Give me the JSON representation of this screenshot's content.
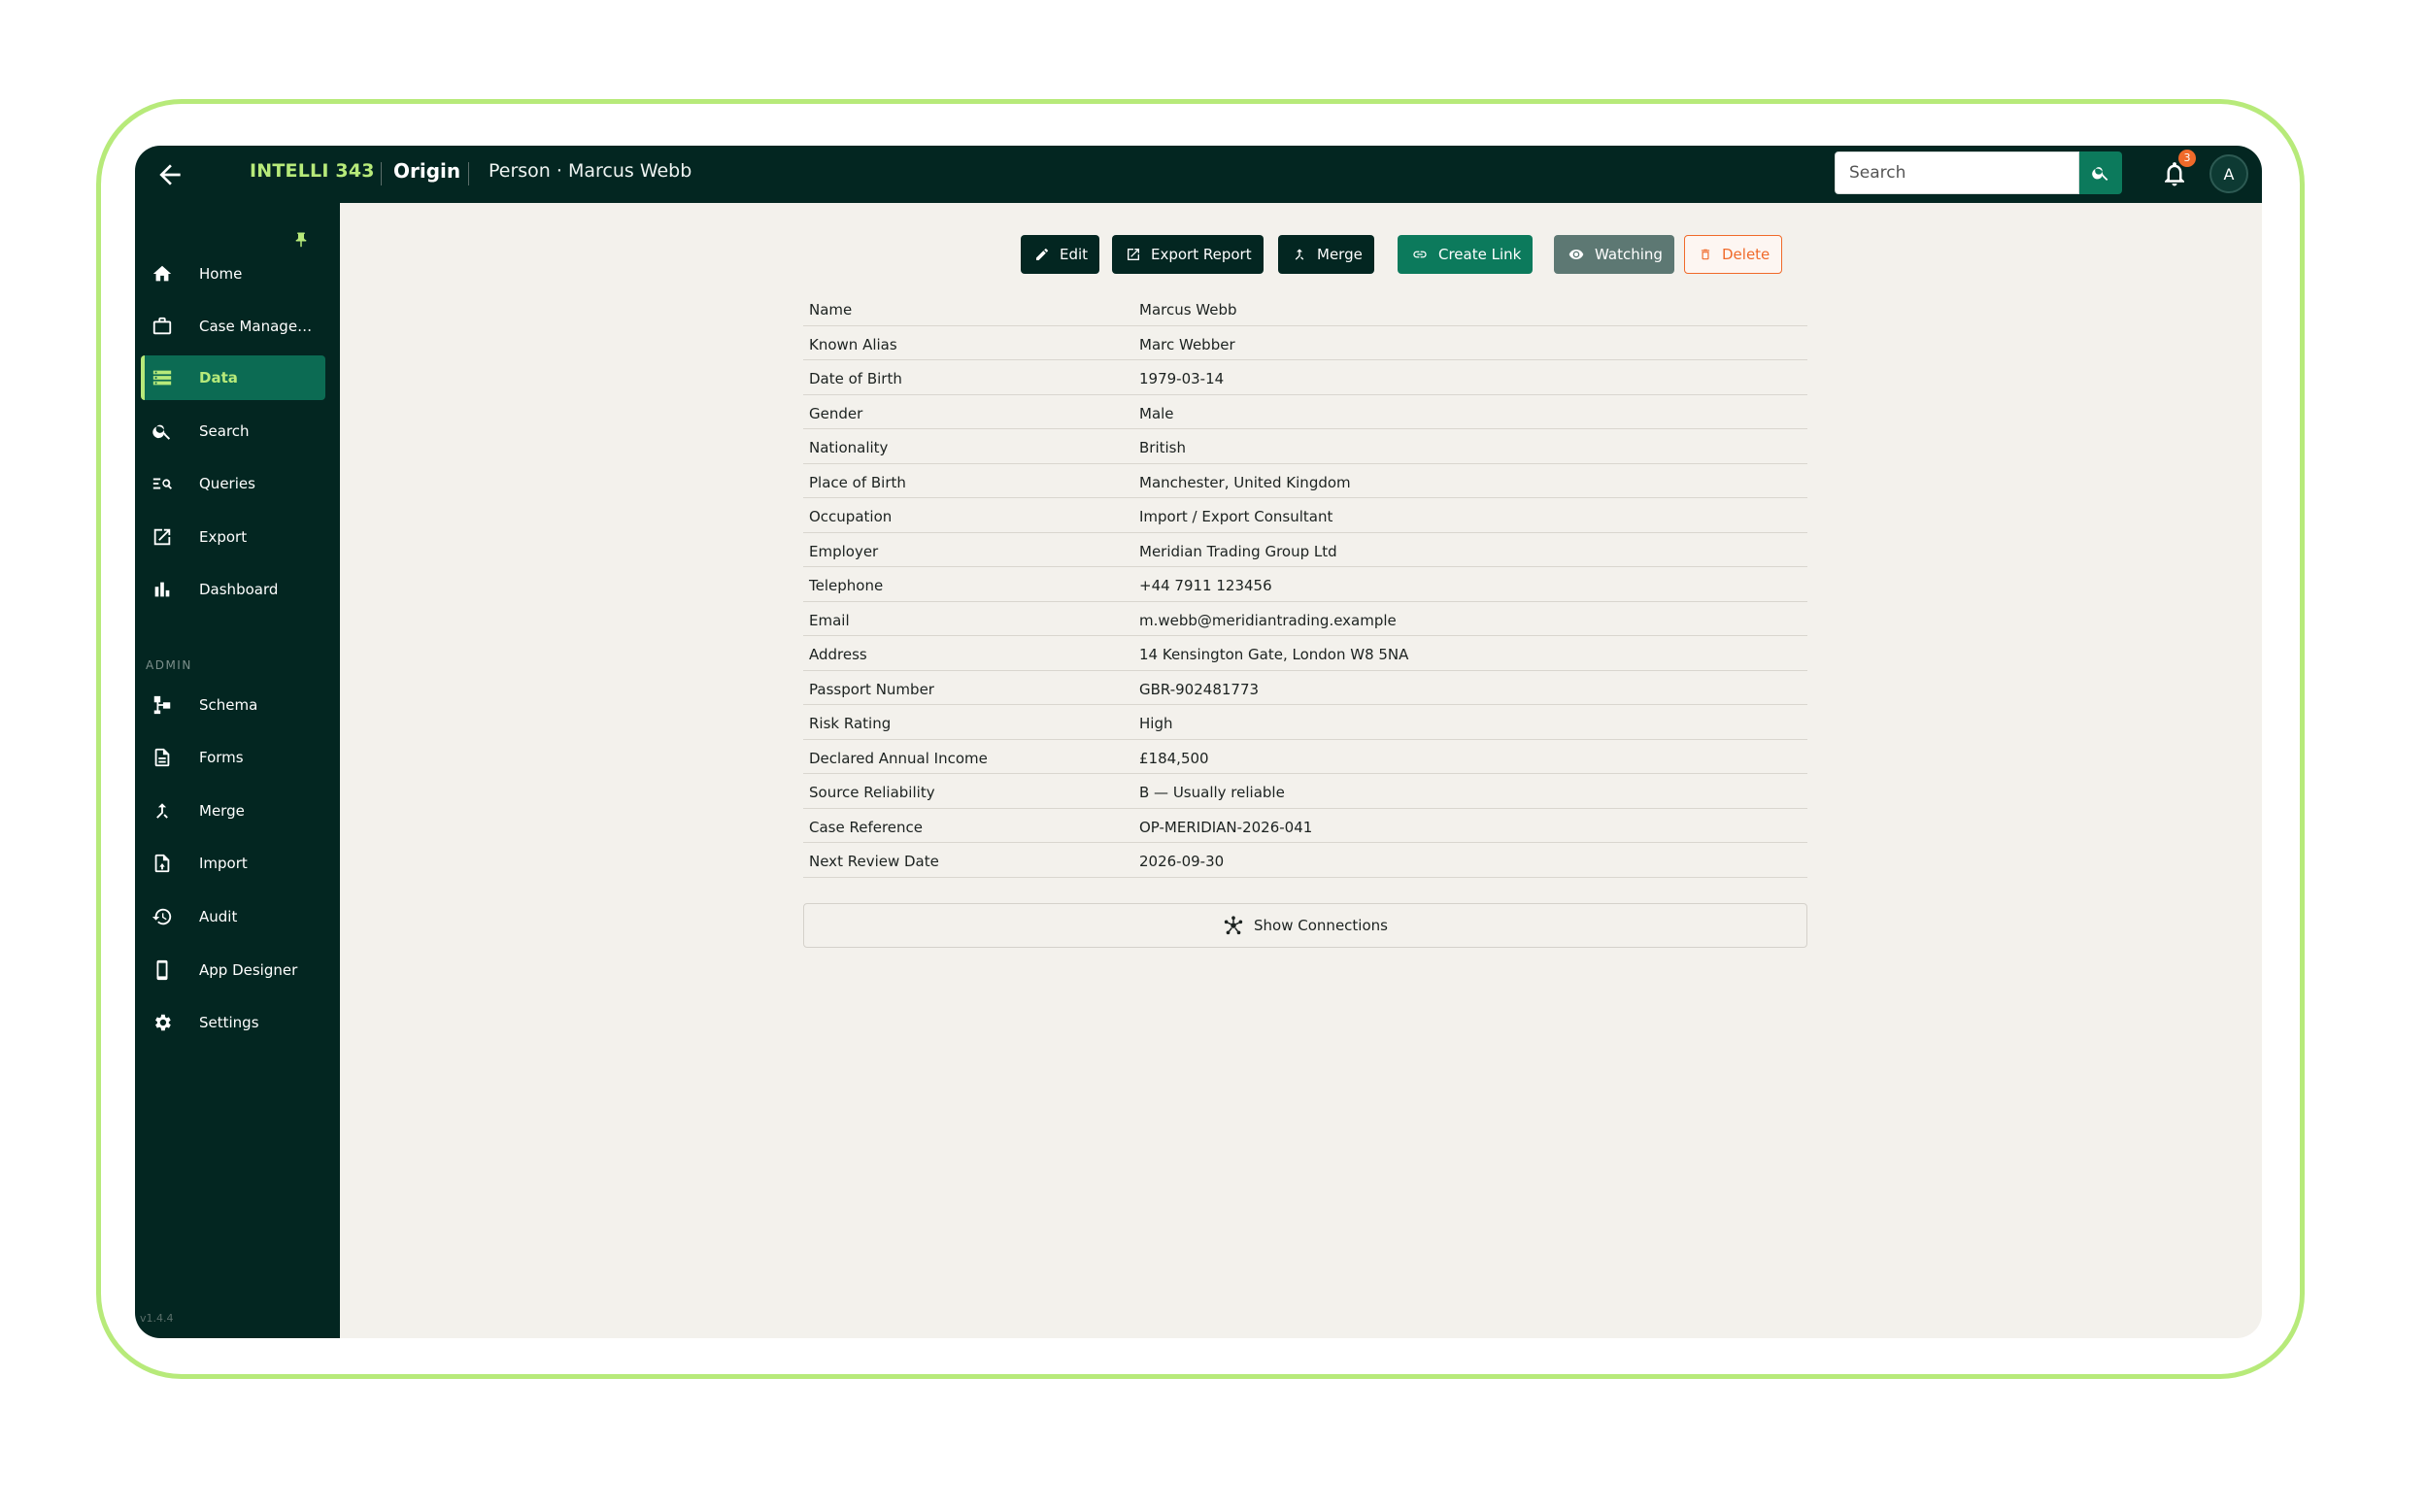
{
  "header": {
    "brand": "INTELLI 343",
    "app_name": "Origin",
    "page_title": "Person · Marcus Webb",
    "search_placeholder": "Search",
    "notification_count": "3",
    "avatar_initial": "A"
  },
  "sidebar": {
    "items": [
      {
        "label": "Home",
        "icon": "home-icon"
      },
      {
        "label": "Case Management",
        "icon": "briefcase-icon"
      },
      {
        "label": "Data",
        "icon": "data-list-icon",
        "active": true
      },
      {
        "label": "Search",
        "icon": "search-icon"
      },
      {
        "label": "Queries",
        "icon": "query-icon"
      },
      {
        "label": "Export",
        "icon": "export-icon"
      },
      {
        "label": "Dashboard",
        "icon": "bar-chart-icon"
      }
    ],
    "admin_label": "ADMIN",
    "admin_items": [
      {
        "label": "Schema",
        "icon": "schema-icon"
      },
      {
        "label": "Forms",
        "icon": "document-icon"
      },
      {
        "label": "Merge",
        "icon": "merge-icon"
      },
      {
        "label": "Import",
        "icon": "import-icon"
      },
      {
        "label": "Audit",
        "icon": "history-icon"
      },
      {
        "label": "App Designer",
        "icon": "phone-icon"
      },
      {
        "label": "Settings",
        "icon": "gear-icon"
      }
    ],
    "version": "v1.4.4"
  },
  "toolbar": {
    "edit": "Edit",
    "export_report": "Export Report",
    "merge": "Merge",
    "create_link": "Create Link",
    "watching": "Watching",
    "delete": "Delete"
  },
  "record": {
    "fields": [
      {
        "key": "Name",
        "value": "Marcus Webb"
      },
      {
        "key": "Known Alias",
        "value": "Marc Webber"
      },
      {
        "key": "Date of Birth",
        "value": "1979-03-14"
      },
      {
        "key": "Gender",
        "value": "Male"
      },
      {
        "key": "Nationality",
        "value": "British"
      },
      {
        "key": "Place of Birth",
        "value": "Manchester, United Kingdom"
      },
      {
        "key": "Occupation",
        "value": "Import / Export Consultant"
      },
      {
        "key": "Employer",
        "value": "Meridian Trading Group Ltd"
      },
      {
        "key": "Telephone",
        "value": "+44 7911 123456"
      },
      {
        "key": "Email",
        "value": "m.webb@meridiantrading.example"
      },
      {
        "key": "Address",
        "value": "14 Kensington Gate, London W8 5NA"
      },
      {
        "key": "Passport Number",
        "value": "GBR-902481773"
      },
      {
        "key": "Risk Rating",
        "value": "High"
      },
      {
        "key": "Declared Annual Income",
        "value": "£184,500"
      },
      {
        "key": "Source Reliability",
        "value": "B — Usually reliable"
      },
      {
        "key": "Case Reference",
        "value": "OP-MERIDIAN-2026-041"
      },
      {
        "key": "Next Review Date",
        "value": "2026-09-30"
      }
    ]
  },
  "connections": {
    "label": "Show Connections"
  },
  "colors": {
    "navy": "#032621",
    "accent_green": "#b7ea7a",
    "teal": "#0c7a5c",
    "danger": "#f06a2a",
    "page_bg": "#f3f1ec"
  }
}
